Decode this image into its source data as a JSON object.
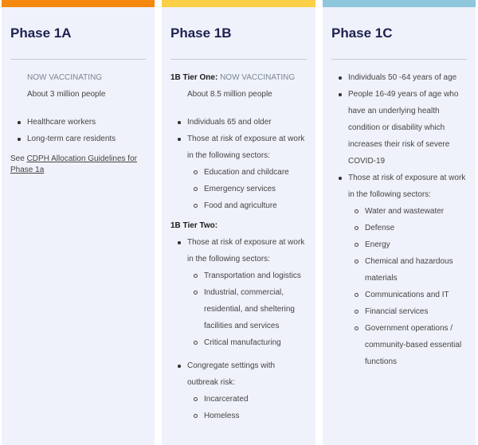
{
  "phases": [
    {
      "title": "Phase 1A",
      "accent_color": "#f5880e",
      "status": "NOW VACCINATING",
      "population": "About 3 million people",
      "groups": [
        "Healthcare workers",
        "Long-term care residents"
      ],
      "see_prefix": "See ",
      "link_text": "CDPH Allocation Guidelines for Phase 1a"
    },
    {
      "title": "Phase 1B",
      "accent_color": "#fbcf46",
      "tier_one": {
        "label": "1B Tier One:",
        "status": "NOW VACCINATING",
        "population": "About 8.5 million people",
        "groups": [
          {
            "text": "Individuals 65 and older"
          },
          {
            "text": "Those at risk of exposure at work in the following sectors:",
            "sectors": [
              "Education and childcare",
              "Emergency services",
              "Food and agriculture"
            ]
          }
        ]
      },
      "tier_two": {
        "label": "1B Tier Two:",
        "groups": [
          {
            "text": "Those at risk of exposure at work in the following sectors:",
            "sectors": [
              "Transportation and logistics",
              "Industrial, commercial, residential, and sheltering facilities and services",
              "Critical manufacturing"
            ]
          },
          {
            "text": "Congregate settings with outbreak risk:",
            "sectors": [
              "Incarcerated",
              "Homeless"
            ]
          }
        ]
      }
    },
    {
      "title": "Phase 1C",
      "accent_color": "#8ec6dc",
      "groups": [
        {
          "text": "Individuals 50 -64 years of age"
        },
        {
          "text": "People 16-49 years of age who have an underlying health condition or disability which increases their risk of severe COVID-19"
        },
        {
          "text": "Those at risk of exposure at work in the following sectors:",
          "sectors": [
            "Water and wastewater",
            "Defense",
            "Energy",
            "Chemical and hazardous materials",
            "Communications and IT",
            "Financial services",
            "Government operations / community-based essential functions"
          ]
        }
      ]
    }
  ]
}
